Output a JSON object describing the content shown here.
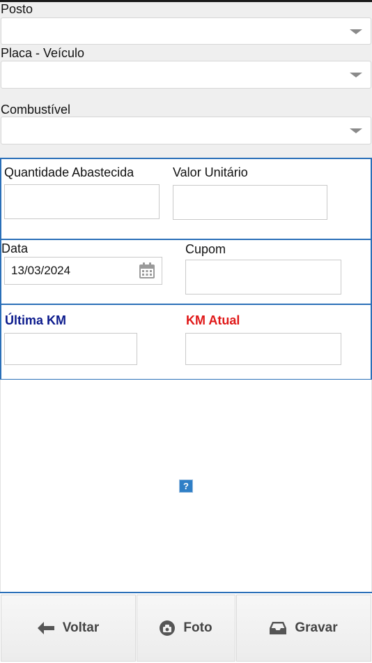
{
  "form": {
    "posto_label": "Posto",
    "placa_label": "Placa - Veículo",
    "combustivel_label": "Combustível",
    "posto_value": "",
    "placa_value": "",
    "combustivel_value": ""
  },
  "abastecimento": {
    "quantidade_label": "Quantidade Abastecida",
    "valor_label": "Valor Unitário",
    "quantidade_value": "",
    "valor_value": ""
  },
  "data_cupom": {
    "data_label": "Data",
    "data_value": "13/03/2024",
    "cupom_label": "Cupom",
    "cupom_value": ""
  },
  "km": {
    "ultima_label": "Última KM",
    "atual_label": "KM Atual",
    "ultima_value": "",
    "atual_value": ""
  },
  "help": {
    "glyph": "?"
  },
  "toolbar": {
    "voltar_label": "Voltar",
    "foto_label": "Foto",
    "gravar_label": "Gravar"
  },
  "colors": {
    "section_border": "#2a6fb8",
    "ultima_km": "#0b1a8c",
    "km_atual": "#e01818",
    "background_gray": "#efefef"
  },
  "icons": {
    "select_caret": "chevron-down-icon",
    "date": "calendar-icon",
    "back": "arrow-left-icon",
    "photo": "camera-icon",
    "save": "inbox-icon",
    "help": "help-icon"
  }
}
